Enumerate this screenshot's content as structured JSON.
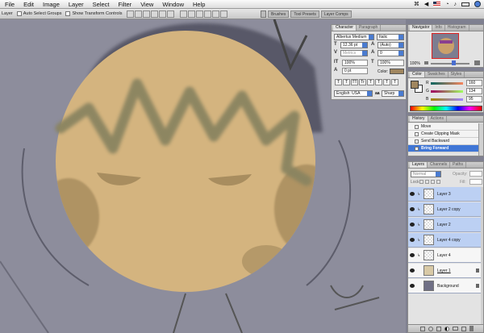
{
  "menubar": {
    "items": [
      "File",
      "Edit",
      "Image",
      "Layer",
      "Select",
      "Filter",
      "View",
      "Window",
      "Help"
    ]
  },
  "options": {
    "tool": "Layer",
    "auto_select": "Auto Select Groups",
    "show_transform": "Show Transform Controls"
  },
  "dock": {
    "tabs": [
      "Brushes",
      "Tool Presets",
      "Layer Comps"
    ]
  },
  "character_panel": {
    "tabs": [
      "Character",
      "Paragraph"
    ],
    "font_family": "Albertus Medium",
    "font_style": "Italic",
    "font_size": "12.36 pt",
    "leading": "(Auto)",
    "kerning": "Metrics",
    "tracking": "0",
    "vscale": "100%",
    "hscale": "100%",
    "baseline": "0 pt",
    "color_label": "Color:",
    "type_buttons": [
      "T",
      "T",
      "TT",
      "Tr",
      "T",
      "T",
      "T",
      "T"
    ],
    "language": "English: USA",
    "aa_label": "aa",
    "antialias": "Sharp"
  },
  "navigator_panel": {
    "tabs": [
      "Navigator",
      "Info",
      "Histogram"
    ],
    "zoom": "100%"
  },
  "color_panel": {
    "tabs": [
      "Color",
      "Swatches",
      "Styles"
    ],
    "r_label": "R",
    "g_label": "G",
    "b_label": "B",
    "r": "160",
    "g": "134",
    "b": "95"
  },
  "history_panel": {
    "tabs": [
      "History",
      "Actions"
    ],
    "items": [
      {
        "label": "Move"
      },
      {
        "label": "Create Clipping Mask"
      },
      {
        "label": "Send Backward"
      },
      {
        "label": "Bring Forward"
      }
    ]
  },
  "layers_panel": {
    "tabs": [
      "Layers",
      "Channels",
      "Paths"
    ],
    "blend_mode": "Normal",
    "opacity_label": "Opacity:",
    "lock_label": "Lock:",
    "fill_label": "Fill:",
    "layers": [
      {
        "name": "Layer 3",
        "selected": true
      },
      {
        "name": "Layer 2 copy",
        "selected": true
      },
      {
        "name": "Layer 2",
        "selected": true
      },
      {
        "name": "Layer 4 copy",
        "selected": true
      },
      {
        "name": "Layer 4",
        "selected": false
      },
      {
        "name": "Layer 1",
        "selected": false
      },
      {
        "name": "Background",
        "selected": false
      }
    ]
  },
  "colors": {
    "face": "#d4b47f",
    "hair": "#8a8460",
    "foreground_swatch": "#a0865f",
    "selection": "#bcd0f3"
  }
}
